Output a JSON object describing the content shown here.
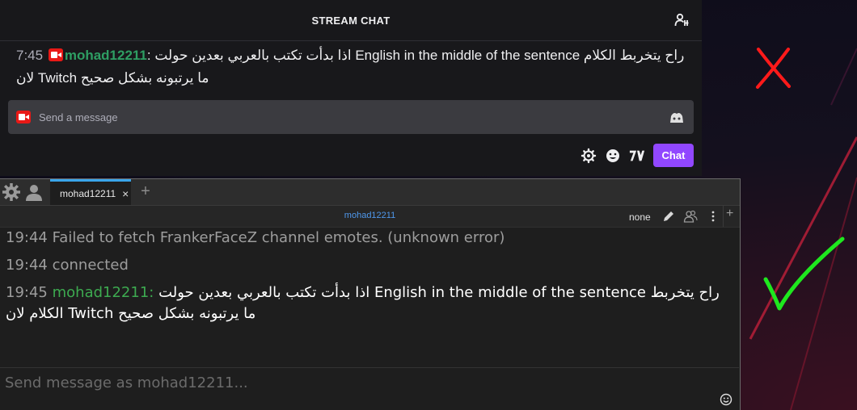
{
  "twitch": {
    "header_title": "STREAM CHAT",
    "message": {
      "time": "7:45",
      "username": "mohad12211",
      "separator": ":",
      "text": "اذا بدأت تكتب بالعربي بعدين حولت English in the middle of the sentence راح يتخربط الكلام لان Twitch ما يرتبونه بشكل صحيح"
    },
    "input_placeholder": "Send a message",
    "chat_button": "Chat",
    "colors": {
      "accent": "#9147ff",
      "username": "#2e9e63",
      "badge": "#e91916"
    }
  },
  "annotations": {
    "wrong": "red-x-mark",
    "right": "green-check-mark"
  },
  "chatterino": {
    "tab_label": "mohad12211",
    "tab_close": "×",
    "add_tab": "+",
    "channel": "mohad12211",
    "mode": "none",
    "add_split": "+",
    "messages": [
      {
        "time": "19:44",
        "text": "Failed to fetch FrankerFaceZ channel emotes. (unknown error)"
      },
      {
        "time": "19:44",
        "text": "connected"
      }
    ],
    "chat_message": {
      "time": "19:45",
      "username": "mohad12211",
      "separator": ":",
      "text": "اذا بدأت تكتب بالعربي بعدين حولت English in the middle of the sentence راح يتخربط الكلام لان Twitch ما يرتبونه بشكل صحيح"
    },
    "input_placeholder": "Send message as mohad12211...",
    "colors": {
      "channel": "#4f98ec",
      "username": "#3daa50",
      "tab_accent": "#3aa5ea"
    }
  }
}
